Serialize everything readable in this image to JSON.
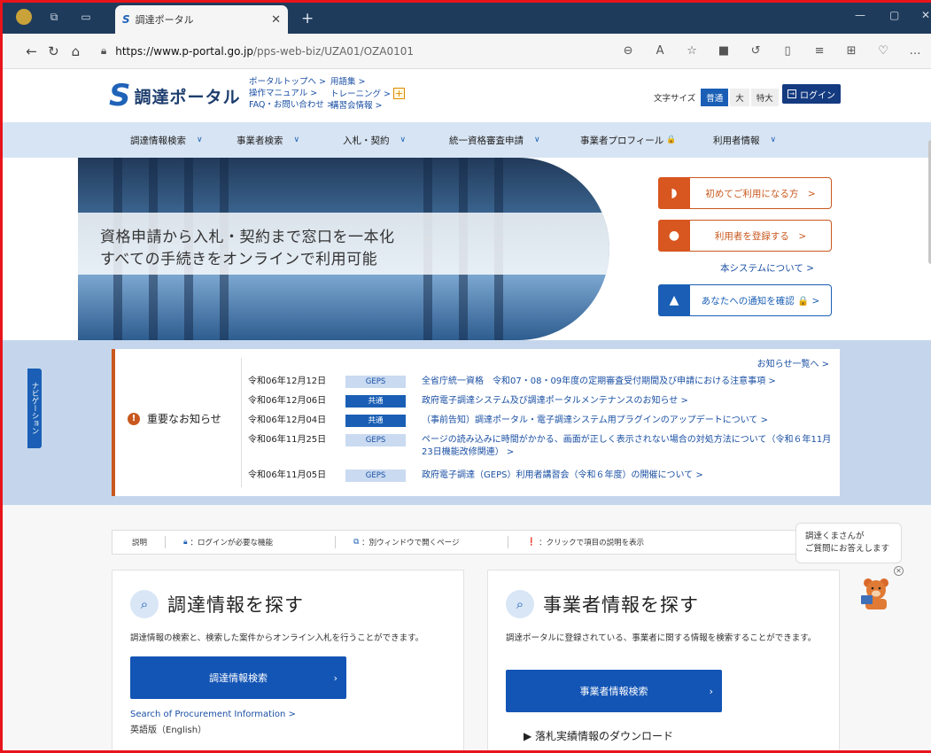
{
  "browser": {
    "tab_title": "調達ポータル",
    "tab_logo": "S",
    "new_tab": "+",
    "url_host": "https://www.p-portal.go.jp",
    "url_path": "/pps-web-biz/UZA01/OZA0101"
  },
  "header": {
    "brand_mark": "S",
    "brand_name": "調達ポータル",
    "links_col1": [
      "ポータルトップへ >",
      "操作マニュアル >",
      "FAQ・お問い合わせ >"
    ],
    "links_col2": [
      "用語集 >",
      "トレーニング >",
      "講習会情報 >"
    ],
    "font_size_label": "文字サイズ",
    "font_sizes": [
      "普通",
      "大",
      "特大"
    ],
    "login_label": "ログイン"
  },
  "mainnav": [
    {
      "label": "調達情報検索",
      "chevron": "∨"
    },
    {
      "label": "事業者検索",
      "chevron": "∨"
    },
    {
      "label": "入札・契約",
      "chevron": "∨"
    },
    {
      "label": "統一資格審査申請",
      "chevron": "∨"
    },
    {
      "label": "事業者プロフィール",
      "chevron": "🔒"
    },
    {
      "label": "利用者情報",
      "chevron": "∨"
    }
  ],
  "hero": {
    "line1": "資格申請から入札・契約まで窓口を一本化",
    "line2": "すべての手続きをオンラインで利用可能",
    "cta_first": "初めてご利用になる方　>",
    "cta_register": "利用者を登録する　>",
    "about": "本システムについて >",
    "cta_notice": "あなたへの通知を確認 🔒 >"
  },
  "side_tab": "ナビゲーション",
  "notices": {
    "heading": "重要なお知らせ",
    "more": "お知らせ一覧へ >",
    "items": [
      {
        "date": "令和06年12月12日",
        "tag": "GEPS",
        "text": "全省庁統一資格　令和07・08・09年度の定期審査受付期間及び申請における注意事項 >"
      },
      {
        "date": "令和06年12月06日",
        "tag": "共通",
        "text": "政府電子調達システム及び調達ポータルメンテナンスのお知らせ >"
      },
      {
        "date": "令和06年12月04日",
        "tag": "共通",
        "text": "（事前告知）調達ポータル・電子調達システム用プラグインのアップデートについて >"
      },
      {
        "date": "令和06年11月25日",
        "tag": "GEPS",
        "text": "ページの読み込みに時間がかかる、画面が正しく表示されない場合の対処方法について（令和６年11月23日機能改修関連） >"
      },
      {
        "date": "令和06年11月05日",
        "tag": "GEPS",
        "text": "政府電子調達（GEPS）利用者講習会（令和６年度）の開催について >"
      }
    ]
  },
  "legend": {
    "label": "説明",
    "login_required": "：ログインが必要な機能",
    "new_window": "：別ウィンドウで開くページ",
    "click_help": "：クリックで項目の説明を表示"
  },
  "panel_procurement": {
    "title": "調達情報を探す",
    "desc": "調達情報の検索と、検索した案件からオンライン入札を行うことができます。",
    "button": "調達情報検索",
    "en_link": "Search of Procurement Information >",
    "en_sub": "英語版（English）"
  },
  "panel_business": {
    "title": "事業者情報を探す",
    "desc": "調達ポータルに登録されている、事業者に関する情報を検索することができます。",
    "button": "事業者情報検索",
    "download": "▶ 落札実績情報のダウンロード"
  },
  "chat": {
    "line1": "調達くまさんが",
    "line2": "ご質問にお答えします"
  }
}
